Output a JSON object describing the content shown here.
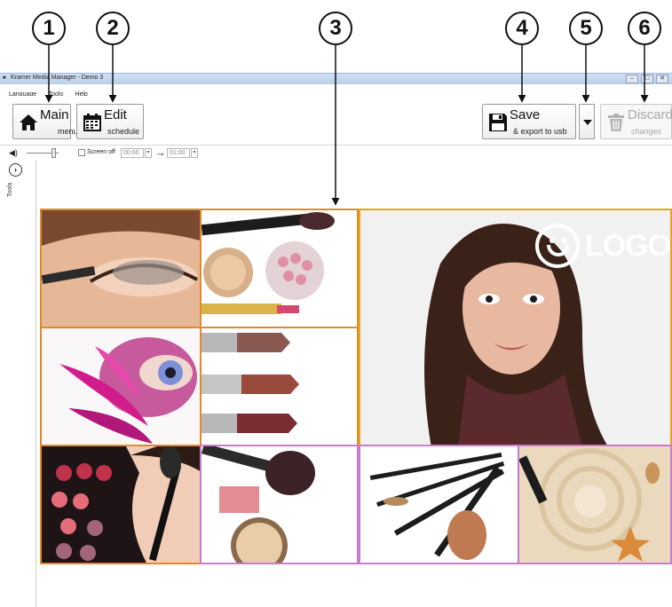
{
  "callouts": [
    "1",
    "2",
    "3",
    "4",
    "5",
    "6"
  ],
  "window": {
    "title": "Kramer Media Manager - Demo 3",
    "controls": [
      "–",
      "□",
      "✕"
    ]
  },
  "menu": [
    "Language",
    "Tools",
    "Help"
  ],
  "toolbar": {
    "main": {
      "label": "Main",
      "sub": "menu",
      "icon": "home-icon"
    },
    "edit": {
      "label": "Edit",
      "sub": "schedule",
      "icon": "calendar-icon"
    },
    "save": {
      "label": "Save",
      "sub": "& export to usb",
      "icon": "floppy-disk-icon"
    },
    "save_dropdown": {
      "icon": "chevron-down-icon"
    },
    "discard": {
      "label": "Discard",
      "sub": "changes",
      "icon": "trash-icon",
      "enabled": false
    }
  },
  "controls": {
    "volume_icon": "speaker-icon",
    "screen_off_label": "Screen off",
    "screen_off_checked": false,
    "start_time": "00:00",
    "end_time": "01:00"
  },
  "tools_panel": {
    "label": "Tools",
    "expand_icon": "chevron-right-icon"
  },
  "canvas": {
    "logo_text": "LOGO",
    "tiles": [
      "eye-makeup-photo",
      "cosmetics-powder-photo",
      "model-portrait-photo",
      "feather-eye-photo",
      "lipsticks-photo",
      "makeup-application-photo",
      "blush-powder-photo",
      "brush-set-photo",
      "sand-seashell-photo"
    ]
  },
  "colors": {
    "orange_frame": "#e08a2a",
    "gold_frame": "#e7a51c",
    "pink_frame": "#c97bcc",
    "titlebar": "#cfe0f3"
  }
}
